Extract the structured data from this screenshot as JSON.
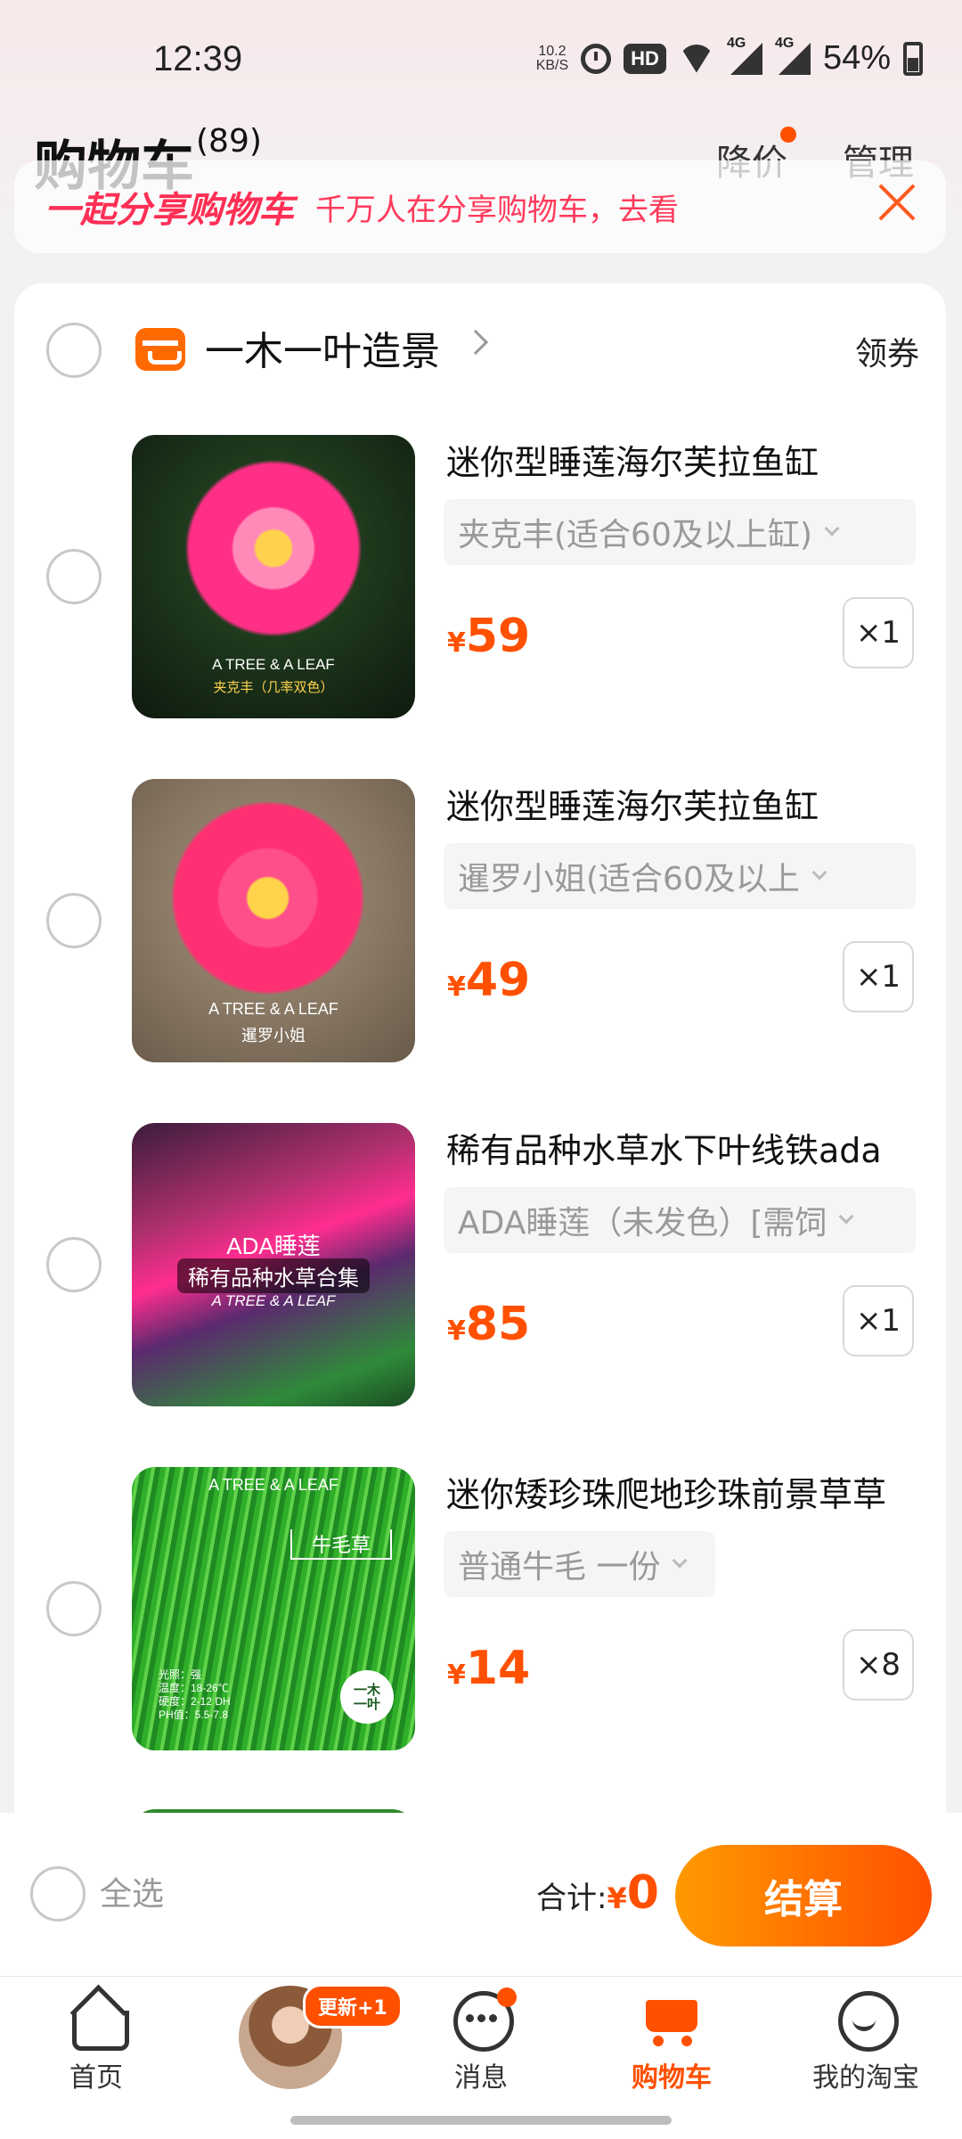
{
  "status_bar": {
    "time": "12:39",
    "net_speed": "10.2",
    "net_unit": "KB/S",
    "hd": "HD",
    "net1": "4G",
    "net2": "4G",
    "battery": "54%"
  },
  "header": {
    "title": "购物车",
    "count": "(89)",
    "price_drop": "降价",
    "manage": "管理"
  },
  "share_banner": {
    "title": "一起分享购物车",
    "text": "千万人在分享购物车，去看"
  },
  "shop": {
    "name": "一木一叶造景",
    "coupon": "领券"
  },
  "items": [
    {
      "name": "迷你型睡莲海尔芙拉鱼缸",
      "sku": "夹克丰(适合60及以上缸)",
      "currency": "¥",
      "price": "59",
      "qty": "×1",
      "img_caption1": "A TREE & A LEAF",
      "img_caption2": "夹克丰（几率双色）"
    },
    {
      "name": "迷你型睡莲海尔芙拉鱼缸",
      "sku": "暹罗小姐(适合60及以上",
      "currency": "¥",
      "price": "49",
      "qty": "×1",
      "img_caption1": "A TREE & A LEAF",
      "img_caption2": "暹罗小姐"
    },
    {
      "name": "稀有品种水草水下叶线铁ada",
      "sku": "ADA睡莲（未发色）[需饲",
      "currency": "¥",
      "price": "85",
      "qty": "×1",
      "img_caption1": "ADA睡莲",
      "img_caption2": "稀有品种水草合集",
      "img_caption3": "A TREE & A LEAF"
    },
    {
      "name": "迷你矮珍珠爬地珍珠前景草草",
      "sku": "普通牛毛 一份",
      "currency": "¥",
      "price": "14",
      "qty": "×8",
      "img_caption1": "A TREE & A LEAF",
      "img_caption2": "牛毛草",
      "img_caption3": "光照：强\n温度：18-26℃\n硬度：2-12 DH\nPH值：5.5-7.8",
      "img_logo": "一木一叶"
    }
  ],
  "footer": {
    "select_all": "全选",
    "total_label": "合计:",
    "currency": "¥",
    "total_value": "0",
    "checkout": "结算"
  },
  "tabs": [
    {
      "label": "首页"
    },
    {
      "label": "",
      "badge": "更新+1"
    },
    {
      "label": "消息"
    },
    {
      "label": "购物车"
    },
    {
      "label": "我的淘宝"
    }
  ],
  "colors": {
    "accent": "#ff5000",
    "share_text": "#ff3b5c"
  }
}
